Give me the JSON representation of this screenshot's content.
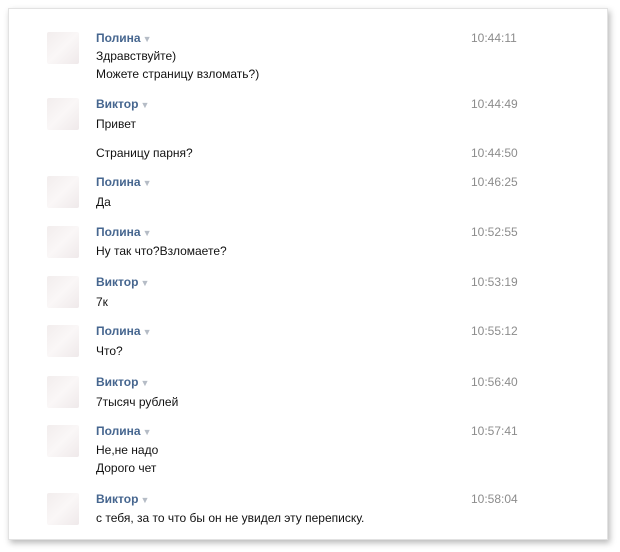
{
  "messages": [
    {
      "author": "Полина",
      "time": "10:44:11",
      "lines": [
        "Здравствуйте)",
        "Можете страницу взломать?)"
      ]
    },
    {
      "author": "Виктор",
      "time": "10:44:49",
      "lines": [
        "Привет"
      ]
    },
    {
      "author": "",
      "time": "10:44:50",
      "lines": [
        "Страницу парня?"
      ]
    },
    {
      "author": "Полина",
      "time": "10:46:25",
      "lines": [
        "Да"
      ]
    },
    {
      "author": "Полина",
      "time": "10:52:55",
      "lines": [
        "Ну так что?Взломаете?"
      ]
    },
    {
      "author": "Виктор",
      "time": "10:53:19",
      "lines": [
        "7к"
      ]
    },
    {
      "author": "Полина",
      "time": "10:55:12",
      "lines": [
        "Что?"
      ]
    },
    {
      "author": "Виктор",
      "time": "10:56:40",
      "lines": [
        "7тысяч рублей"
      ]
    },
    {
      "author": "Полина",
      "time": "10:57:41",
      "lines": [
        "Не,не надо",
        "Дорого чет"
      ]
    },
    {
      "author": "Виктор",
      "time": "10:58:04",
      "lines": [
        "с тебя, за то что бы он не увидел эту переписку."
      ]
    }
  ],
  "ui": {
    "dropdown_glyph": "▼"
  }
}
